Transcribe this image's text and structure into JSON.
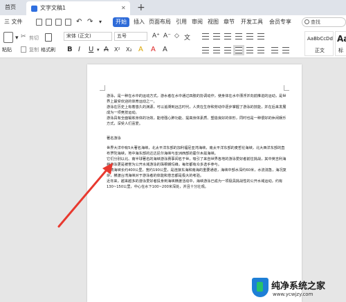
{
  "tabs": {
    "home": "首页",
    "doc_title": "文字文稿1",
    "close": "✕",
    "new_tab": "+"
  },
  "menu": {
    "file": "三 文件",
    "items": [
      "开始",
      "插入",
      "页面布局",
      "引用",
      "审阅",
      "视图",
      "章节",
      "开发工具",
      "会员专享"
    ],
    "search_placeholder": "查找"
  },
  "ribbon": {
    "paste": "粘贴",
    "cut": "剪切",
    "copy": "复制",
    "format_painter": "格式刷",
    "font_name": "宋体 (正文)",
    "font_size": "五号",
    "bold": "B",
    "italic": "I",
    "underline": "U",
    "styles": {
      "normal_preview": "AaBbCcDd",
      "normal_label": "正文",
      "heading_preview": "Aa",
      "heading_label": "标"
    }
  },
  "document": {
    "paragraphs": [
      "游泳，是一种在水中的运动方式，游水者在水中通过四肢的协调动作，使身体在水中漂浮并向前推进的运动，是世界上最受欢迎的体育运动之一。",
      "游泳在历史上有着悠久的渊源，可以追溯到远古时代，人类在生存和劳动中逐步掌握了游泳的技能，并在后来发展成为一项竞技运动。",
      "游泳具有全面锻炼身体的功效，能增强心肺功能、提高身体素质、塑造良好的体形，同时也是一种很好的休闲娱乐方式，深受人们喜爱。"
    ],
    "heading": "著名游泳",
    "body": [
      "世界大洋中有5大著名海峡，北太平洋东部的加利福尼亚湾海峡，南太平洋东部的麦哲伦海峡，北大西洋东部的直布罗陀海峡，地中海东部的达达尼尔海峡与亚洲西部的霍尔木兹海峡。",
      "它们分别以北、南半球著名的海峡游泳赛事闻名于世，吸引了来自世界各地的游泳爱好者前往挑战，其中英吉利海峡游泳更是被誉为公开水域游泳的珠穆朗玛峰，每年都有众多选手参与。",
      "台湾海峡长约400公里，宽约190公里，是连接东海和南海的重要通道，海峡中部水深约60米，水流湍急，海况复杂，横渡台湾海峡对于游泳者的体能和意志都是极大的考验。",
      "近年来，越来越多的游泳爱好者投身到海峡横渡活动中，海峡游泳已成为一项极具挑战性的公开水域运动，约有130~150公里，中心在水下100~200米深处，并且十分壮观。"
    ]
  },
  "watermark": {
    "title": "纯净系统之家",
    "url": "www.ycwjzy.com"
  },
  "colors": {
    "accent": "#2e6bd8",
    "arrow": "#e8392f"
  }
}
